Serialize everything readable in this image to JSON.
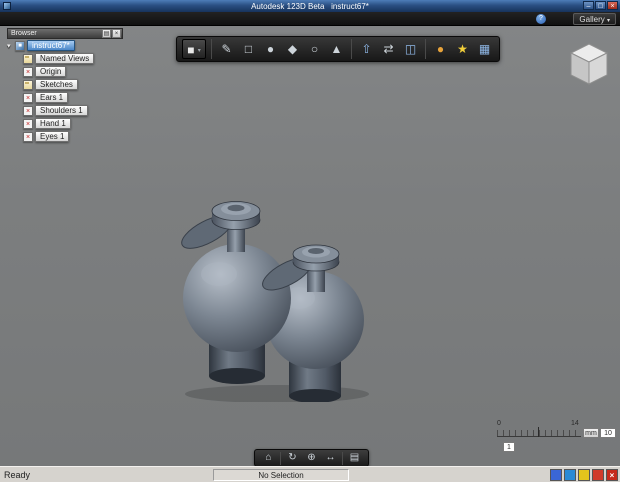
{
  "window": {
    "title": "Autodesk 123D Beta",
    "document": "instruct67*",
    "controls": {
      "minimize": "–",
      "maximize": "□",
      "close": "×"
    }
  },
  "menubar": {
    "gallery_label": "Gallery",
    "gallery_chevron": "▾",
    "help_glyph": "?"
  },
  "browser": {
    "title": "Browser",
    "menu_glyph": "▤",
    "close_glyph": "×",
    "expander": "▾",
    "root_label": "instruct67*",
    "root_icon": "■",
    "items": [
      {
        "label": "Named Views",
        "icon": "folder-icon",
        "mark": ""
      },
      {
        "label": "Origin",
        "icon": "hidden-feature-icon",
        "mark": "×"
      },
      {
        "label": "Sketches",
        "icon": "folder-icon",
        "mark": ""
      },
      {
        "label": "Ears 1",
        "icon": "hidden-feature-icon",
        "mark": "×"
      },
      {
        "label": "Shoulders 1",
        "icon": "hidden-feature-icon",
        "mark": "×"
      },
      {
        "label": "Hand 1",
        "icon": "hidden-feature-icon",
        "mark": "×"
      },
      {
        "label": "Eyes 1",
        "icon": "hidden-feature-icon",
        "mark": "×"
      }
    ]
  },
  "toolbar": {
    "tools": [
      {
        "name": "primitives-menu",
        "glyph": "■",
        "caret": "▾"
      },
      {
        "name": "sketch",
        "glyph": "✎"
      },
      {
        "name": "box",
        "glyph": "□"
      },
      {
        "name": "sphere",
        "glyph": "●"
      },
      {
        "name": "wedge",
        "glyph": "◆"
      },
      {
        "name": "torus",
        "glyph": "○"
      },
      {
        "name": "cone",
        "glyph": "▲"
      },
      {
        "name": "extrude",
        "glyph": "⇧"
      },
      {
        "name": "mirror",
        "glyph": "⇄"
      },
      {
        "name": "combine",
        "glyph": "◫"
      },
      {
        "name": "material",
        "glyph": "●"
      },
      {
        "name": "effects",
        "glyph": "★"
      },
      {
        "name": "snap-grid",
        "glyph": "▦"
      }
    ]
  },
  "bottom_toolbar": {
    "tools": [
      {
        "name": "view-home",
        "glyph": "⌂"
      },
      {
        "name": "orbit",
        "glyph": "↻"
      },
      {
        "name": "zoom",
        "glyph": "⊕"
      },
      {
        "name": "pan",
        "glyph": "↔"
      },
      {
        "name": "view-settings",
        "glyph": "▤"
      }
    ]
  },
  "scale": {
    "min_label": "0",
    "max_label": "14",
    "unit": "mm",
    "value": "10",
    "increment": "1"
  },
  "statusbar": {
    "ready": "Ready",
    "selection": "No Selection",
    "close_glyph": "×"
  },
  "colors": {
    "canvas_gray": "#7d7f80",
    "model_gray_blue": "#6e7884",
    "accent_blue": "#3a66d6",
    "warn_yellow": "#e3c41c",
    "alert_red": "#d03a2a"
  }
}
